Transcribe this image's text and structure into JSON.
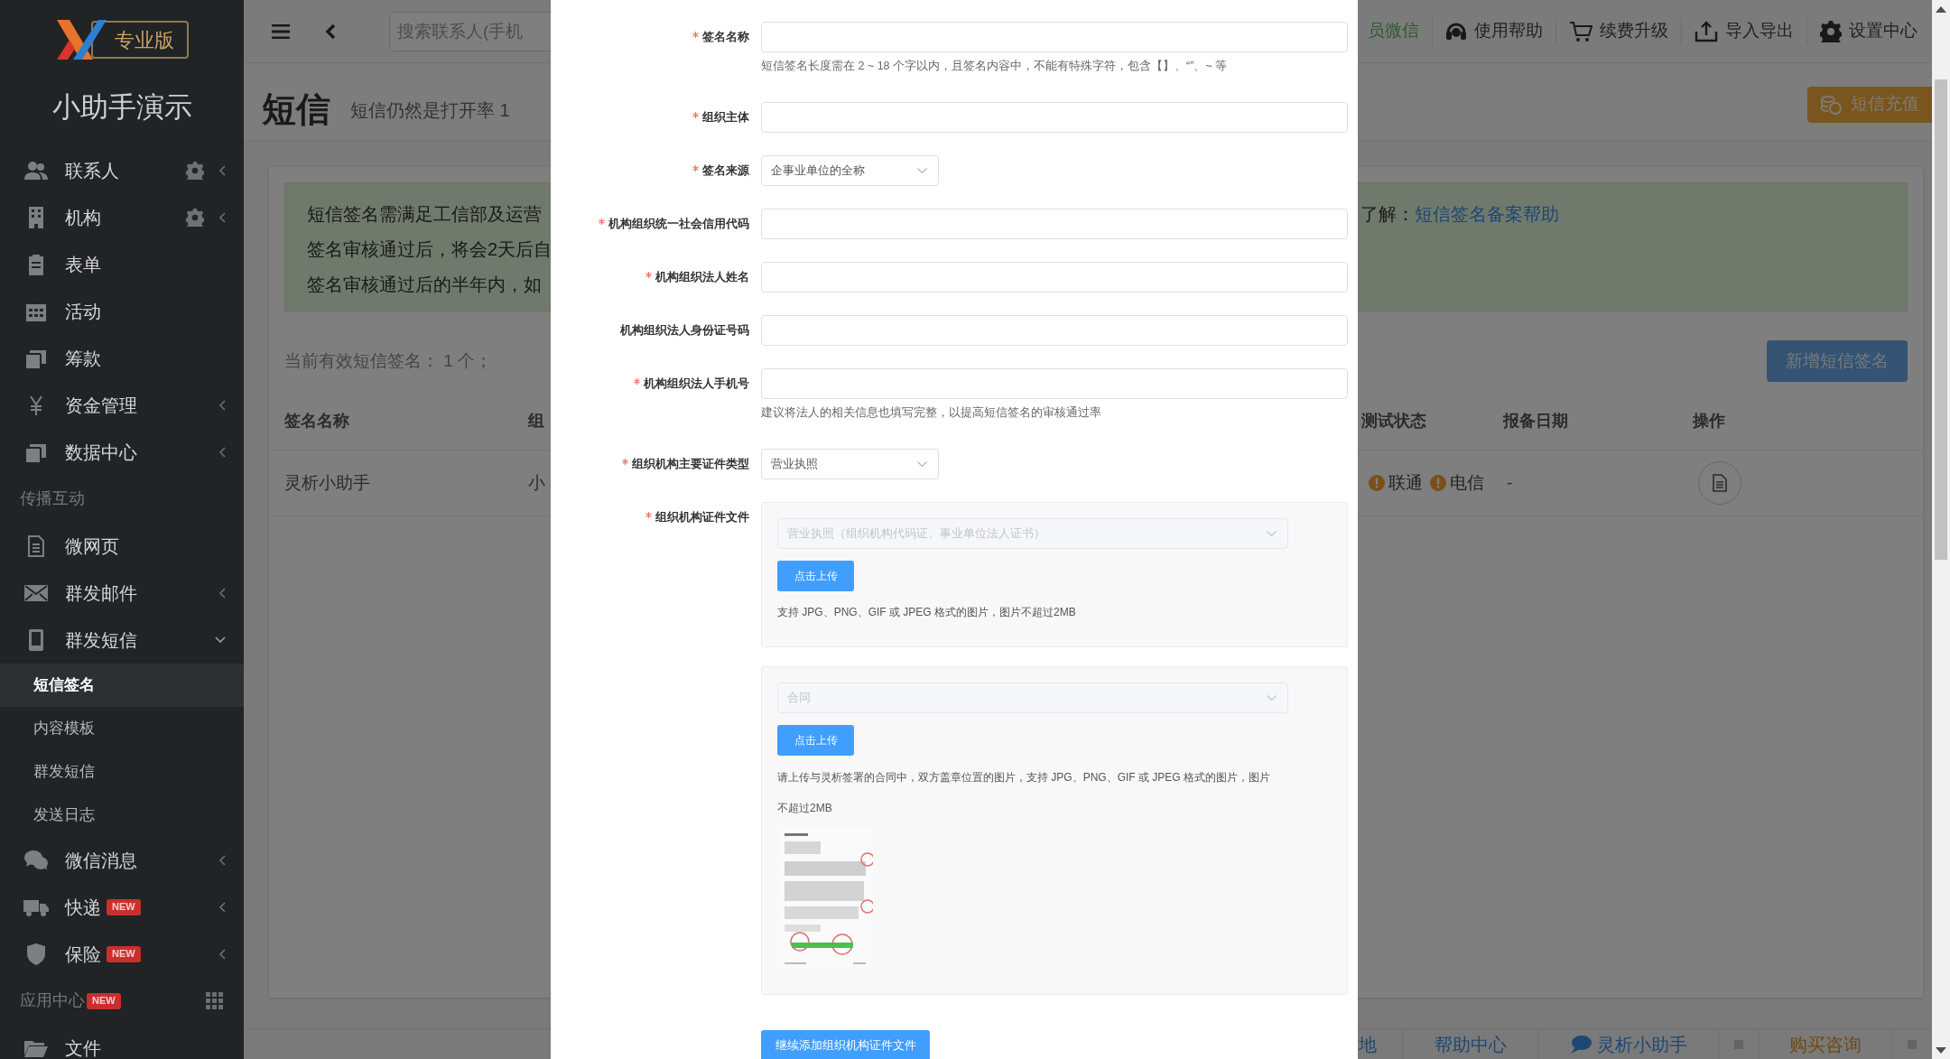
{
  "sidebar": {
    "logo_badge": "专业版",
    "account_name": "小助手演示",
    "items": [
      {
        "kind": "item",
        "label": "联系人",
        "gear": true,
        "expanded": false,
        "selected": false
      },
      {
        "kind": "item",
        "label": "机构",
        "gear": true,
        "expanded": false,
        "selected": false
      },
      {
        "kind": "item",
        "label": "表单",
        "selected": false
      },
      {
        "kind": "item",
        "label": "活动",
        "selected": false
      },
      {
        "kind": "item",
        "label": "筹款",
        "selected": false
      },
      {
        "kind": "item",
        "label": "资金管理",
        "expanded": false,
        "selected": false
      },
      {
        "kind": "item",
        "label": "数据中心",
        "expanded": false,
        "selected": false
      },
      {
        "kind": "section",
        "label": "传播互动"
      },
      {
        "kind": "item",
        "label": "微网页",
        "selected": false
      },
      {
        "kind": "item",
        "label": "群发邮件",
        "expanded": false,
        "selected": false
      },
      {
        "kind": "item",
        "label": "群发短信",
        "expanded": true,
        "selected": false
      },
      {
        "kind": "subitem",
        "label": "短信签名",
        "selected": true
      },
      {
        "kind": "subitem",
        "label": "内容模板",
        "selected": false
      },
      {
        "kind": "subitem",
        "label": "群发短信",
        "selected": false
      },
      {
        "kind": "subitem",
        "label": "发送日志",
        "selected": false
      },
      {
        "kind": "item",
        "label": "微信消息",
        "expanded": false,
        "selected": false
      },
      {
        "kind": "item",
        "label": "快递",
        "badge": "NEW",
        "expanded": false,
        "selected": false
      },
      {
        "kind": "item",
        "label": "保险",
        "badge": "NEW",
        "expanded": false,
        "selected": false
      },
      {
        "kind": "section",
        "label": "应用中心",
        "badge": "NEW"
      },
      {
        "kind": "item",
        "label": "文件",
        "selected": false
      }
    ]
  },
  "header": {
    "search": {
      "placeholder": "搜索联系人(手机"
    },
    "links": [
      {
        "label": "员微信",
        "highlight": true
      },
      {
        "label": "使用帮助",
        "highlight": false
      },
      {
        "label": "续费升级",
        "highlight": false
      },
      {
        "label": "导入导出",
        "highlight": false
      },
      {
        "label": "设置中心",
        "highlight": false
      }
    ]
  },
  "page": {
    "title": "短信",
    "subtitle": "短信仍然是打开率 1",
    "recharge_button": "短信充值",
    "notice": {
      "lines": [
        "短信签名需满足工信部及运营",
        "签名审核通过后，将会2天后自",
        "签名审核通过后的半年内，如"
      ],
      "right_text": "了解：",
      "link": "短信签名备案帮助"
    },
    "count_text": "当前有效短信签名： 1 个；",
    "add_button": "新增短信签名",
    "table": {
      "columns_left": [
        "签名名称",
        "组"
      ],
      "columns_right": [
        "测试状态",
        "报备日期",
        "操作"
      ],
      "rows": [
        {
          "cells_left": [
            "灵析小助手",
            "小"
          ],
          "test_status": [
            {
              "label": "联通",
              "warning": true
            },
            {
              "label": "电信",
              "warning": true
            }
          ],
          "date": "-"
        }
      ]
    }
  },
  "footer": {
    "items": [
      {
        "kind": "link",
        "label": "地"
      },
      {
        "kind": "link",
        "label": "帮助中心"
      },
      {
        "kind": "chat",
        "label": "灵析小助手"
      },
      {
        "kind": "square"
      },
      {
        "kind": "promo",
        "label": "购买咨询"
      },
      {
        "kind": "square"
      }
    ]
  },
  "form": {
    "fields": [
      {
        "kind": "text",
        "label": "签名名称",
        "required": true,
        "hint": "短信签名长度需在 2 ~ 18 个字以内，且签名内容中，不能有特殊字符，包含【】、“”、~ 等"
      },
      {
        "kind": "text",
        "label": "组织主体",
        "required": true
      },
      {
        "kind": "select",
        "label": "签名来源",
        "required": true,
        "value": "企事业单位的全称"
      },
      {
        "kind": "text",
        "label": "机构组织统一社会信用代码",
        "required": true
      },
      {
        "kind": "text",
        "label": "机构组织法人姓名",
        "required": true
      },
      {
        "kind": "text",
        "label": "机构组织法人身份证号码",
        "required": false
      },
      {
        "kind": "text",
        "label": "机构组织法人手机号",
        "required": true,
        "hint": "建议将法人的相关信息也填写完整，以提高短信签名的审核通过率"
      },
      {
        "kind": "select",
        "label": "组织机构主要证件类型",
        "required": true,
        "value": "营业执照"
      },
      {
        "kind": "files",
        "label": "组织机构证件文件",
        "required": true,
        "panels": [
          {
            "placeholder": "营业执照（组织机构代码证、事业单位法人证书）",
            "disabled": true,
            "upload_button": "点击上传",
            "hint": "支持 JPG、PNG、GIF 或 JPEG 格式的图片，图片不超过2MB"
          },
          {
            "placeholder": "合同",
            "disabled": true,
            "upload_button": "点击上传",
            "hint": "请上传与灵析签署的合同中，双方盖章位置的图片，支持 JPG、PNG、GIF 或 JPEG 格式的图片，图片不超过2MB"
          }
        ]
      }
    ],
    "add_more_button": "继续添加组织机构证件文件"
  }
}
